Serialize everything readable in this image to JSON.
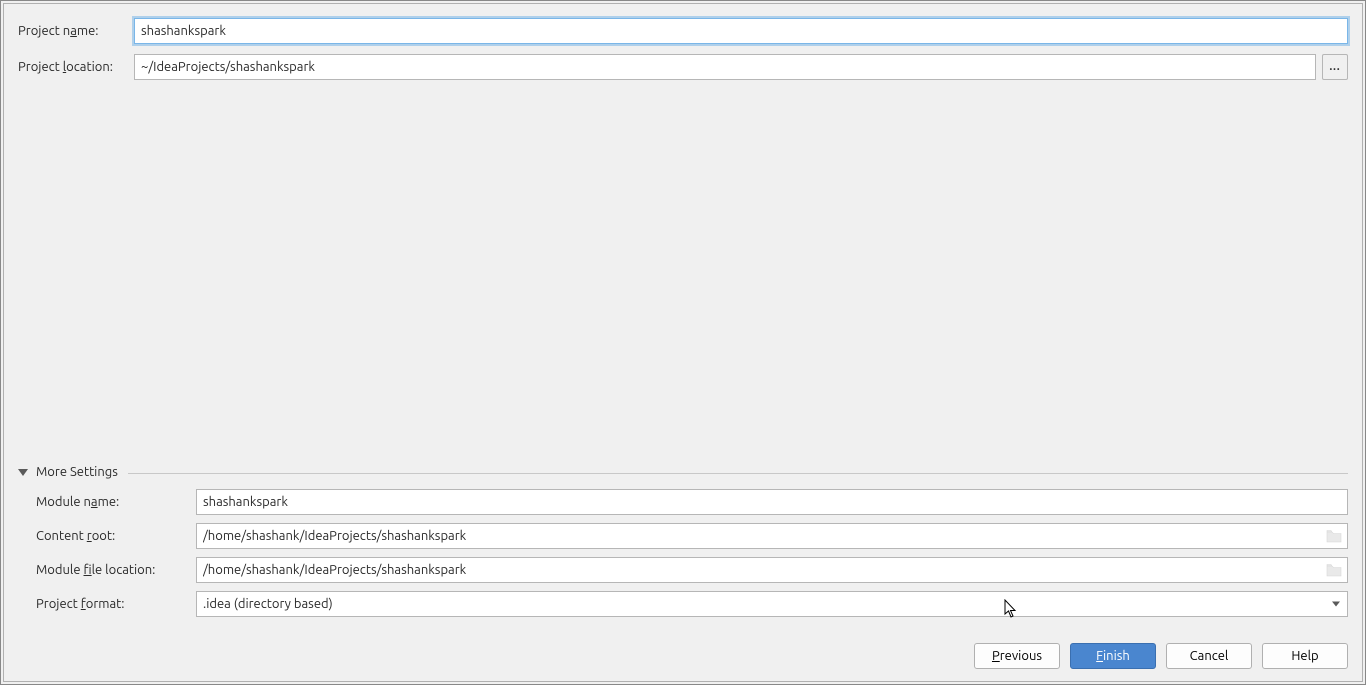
{
  "labels": {
    "project_name": "Project name:",
    "project_location": "Project location:",
    "more_settings": "More Settings",
    "module_name": "Module name:",
    "content_root": "Content root:",
    "module_file_location": "Module file location:",
    "project_format": "Project format:"
  },
  "fields": {
    "project_name": "shashankspark",
    "project_location": "~/IdeaProjects/shashankspark",
    "module_name": "shashankspark",
    "content_root": "/home/shashank/IdeaProjects/shashankspark",
    "module_file_location": "/home/shashank/IdeaProjects/shashankspark",
    "project_format": ".idea (directory based)"
  },
  "buttons": {
    "browse": "...",
    "previous": "Previous",
    "finish": "Finish",
    "cancel": "Cancel",
    "help": "Help"
  },
  "mnemonics": {
    "project_name_u": "a",
    "project_location_u": "l",
    "module_name_u": "a",
    "content_root_u": "r",
    "module_file_location_u": "f",
    "project_format_u": "f",
    "previous_u": "P",
    "finish_u": "F"
  }
}
